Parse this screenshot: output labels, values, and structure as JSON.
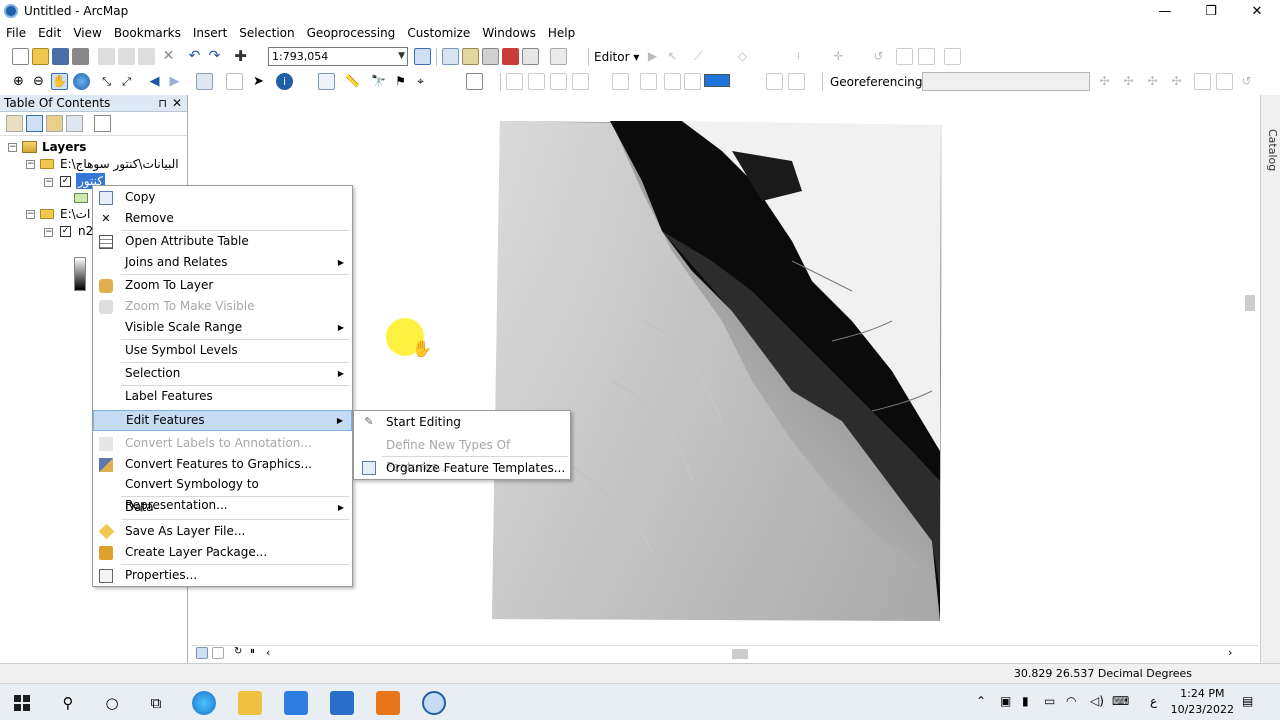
{
  "window": {
    "title": "Untitled - ArcMap",
    "minimize": "—",
    "restore": "❐",
    "close": "✕"
  },
  "menubar": [
    "File",
    "Edit",
    "View",
    "Bookmarks",
    "Insert",
    "Selection",
    "Geoprocessing",
    "Customize",
    "Windows",
    "Help"
  ],
  "toolbar": {
    "scale": "1:793,054",
    "editor_label": "Editor ▾",
    "georef_label": "Georeferencing ▾"
  },
  "toc": {
    "title": "Table Of Contents",
    "pin": "⊓",
    "close": "✕",
    "root": "Layers",
    "group1": "E:\\البيانات\\كنتور سوهاج",
    "layer1": "كنتور",
    "group2": "E:\\ات",
    "layer2": "n2"
  },
  "context_menu": {
    "items": [
      {
        "label": "Copy",
        "icon": "copy-icon"
      },
      {
        "label": "Remove",
        "icon": "remove-icon"
      },
      {
        "label": "Open Attribute Table",
        "icon": "table-icon"
      },
      {
        "label": "Joins and Relates",
        "icon": ""
      },
      {
        "label": "Zoom To Layer",
        "icon": "zoom-layer-icon"
      },
      {
        "label": "Zoom To Make Visible",
        "icon": "zoom-visible-icon"
      },
      {
        "label": "Visible Scale Range",
        "icon": ""
      },
      {
        "label": "Use Symbol Levels",
        "icon": ""
      },
      {
        "label": "Selection",
        "icon": ""
      },
      {
        "label": "Label Features",
        "icon": ""
      },
      {
        "label": "Edit Features",
        "icon": ""
      },
      {
        "label": "Convert Labels to Annotation...",
        "icon": "convert-labels-icon"
      },
      {
        "label": "Convert Features to Graphics...",
        "icon": "convert-graphics-icon"
      },
      {
        "label": "Convert Symbology to Representation...",
        "icon": ""
      },
      {
        "label": "Data",
        "icon": ""
      },
      {
        "label": "Save As Layer File...",
        "icon": "layer-file-icon"
      },
      {
        "label": "Create Layer Package...",
        "icon": "package-icon"
      },
      {
        "label": "Properties...",
        "icon": "properties-icon"
      }
    ]
  },
  "submenu": {
    "items": [
      {
        "label": "Start Editing"
      },
      {
        "label": "Define New Types Of Features..."
      },
      {
        "label": "Organize Feature Templates..."
      }
    ]
  },
  "statusbar": {
    "coords": "30.829  26.537 Decimal Degrees"
  },
  "side_tab": "Catalog",
  "taskbar": {
    "time": "1:24 PM",
    "date": "10/23/2022",
    "lang": "ع"
  }
}
